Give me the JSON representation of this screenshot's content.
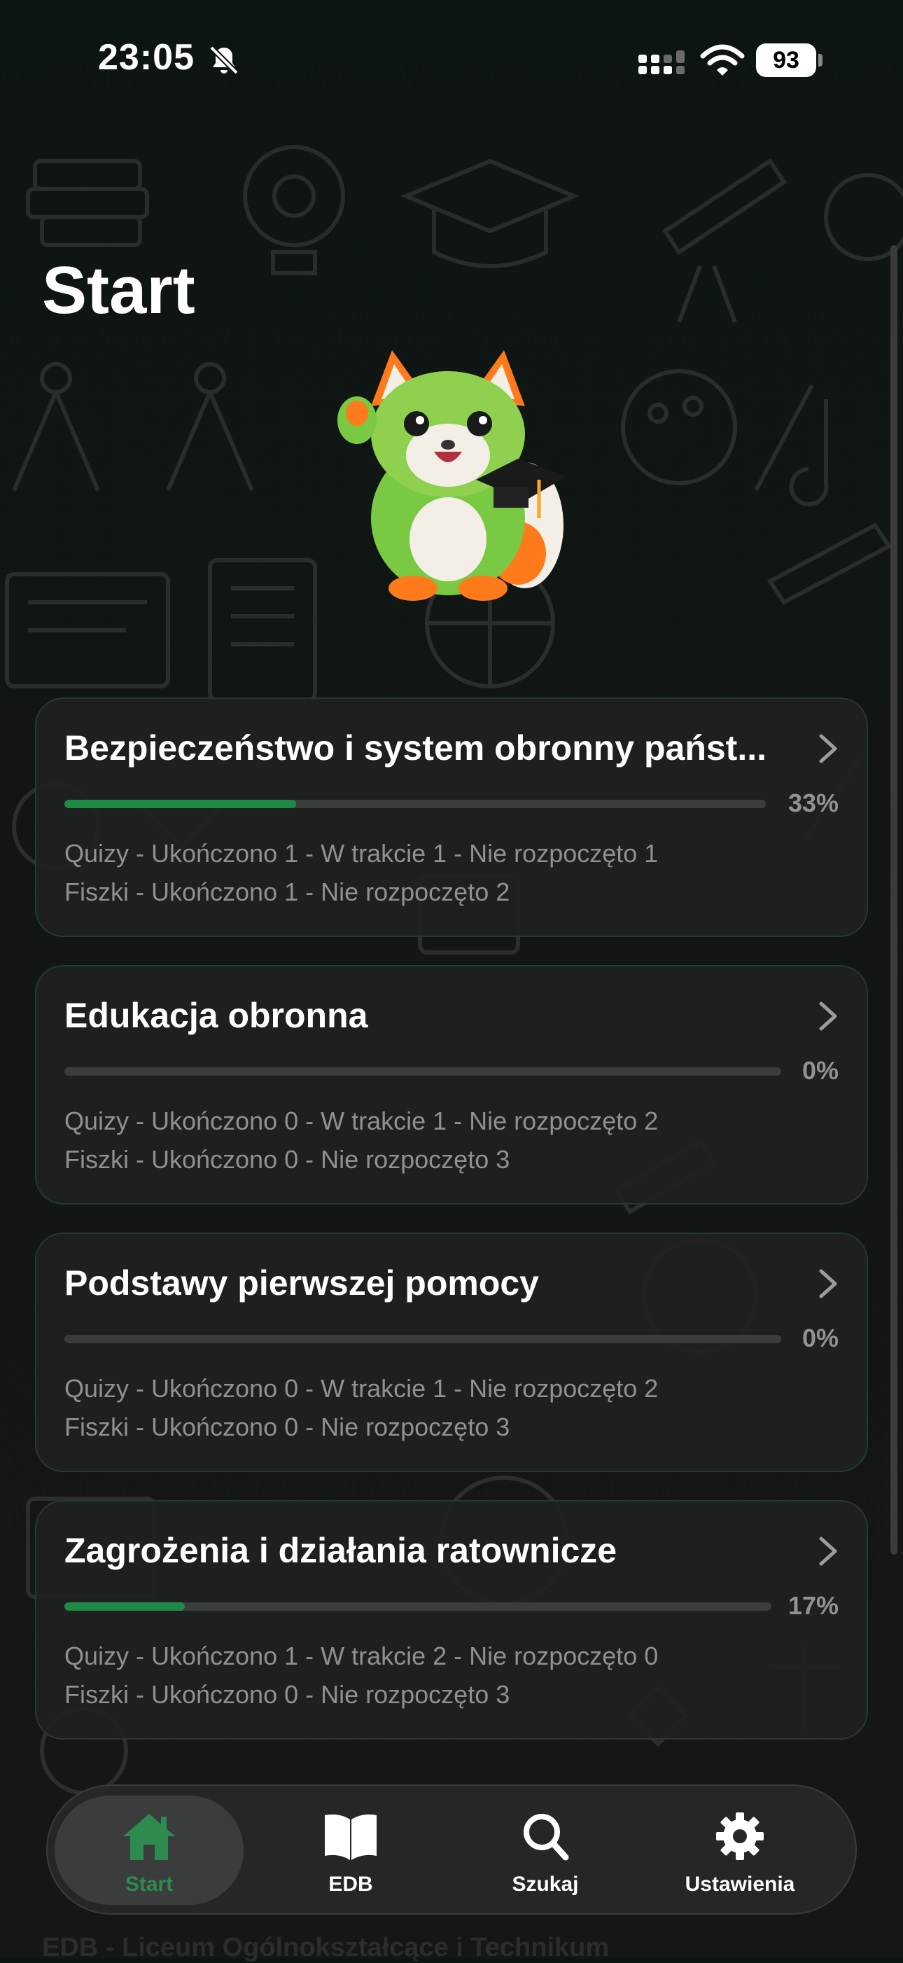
{
  "status_bar": {
    "time": "23:05",
    "battery": "93"
  },
  "page": {
    "title": "Start"
  },
  "cards": [
    {
      "title": "Bezpieczeństwo i system obronny państ...",
      "progress_pct": 33,
      "percent_label": "33%",
      "quizzes": "Quizy - Ukończono 1 - W trakcie 1 - Nie rozpoczęto 1",
      "flashcards": "Fiszki - Ukończono 1 - Nie rozpoczęto 2"
    },
    {
      "title": "Edukacja obronna",
      "progress_pct": 0,
      "percent_label": "0%",
      "quizzes": "Quizy - Ukończono 0 - W trakcie 1 - Nie rozpoczęto 2",
      "flashcards": "Fiszki - Ukończono 0 - Nie rozpoczęto 3"
    },
    {
      "title": "Podstawy pierwszej pomocy",
      "progress_pct": 0,
      "percent_label": "0%",
      "quizzes": "Quizy - Ukończono 0 - W trakcie 1 - Nie rozpoczęto 2",
      "flashcards": "Fiszki - Ukończono 0 - Nie rozpoczęto 3"
    },
    {
      "title": "Zagrożenia i działania ratownicze",
      "progress_pct": 17,
      "percent_label": "17%",
      "quizzes": "Quizy - Ukończono 1 - W trakcie 2 - Nie rozpoczęto 0",
      "flashcards": "Fiszki - Ukończono 0 - Nie rozpoczęto 3"
    }
  ],
  "nav": {
    "items": [
      {
        "label": "Start",
        "icon": "home-icon",
        "active": true
      },
      {
        "label": "EDB",
        "icon": "book-icon",
        "active": false
      },
      {
        "label": "Szukaj",
        "icon": "search-icon",
        "active": false
      },
      {
        "label": "Ustawienia",
        "icon": "gear-icon",
        "active": false
      }
    ]
  },
  "footer_peek": "EDB - Liceum Ogólnokształcące i Technikum",
  "colors": {
    "accent": "#1f8a46",
    "active_nav": "#2e8b4f",
    "background": "#111614",
    "card": "#1e2220"
  }
}
